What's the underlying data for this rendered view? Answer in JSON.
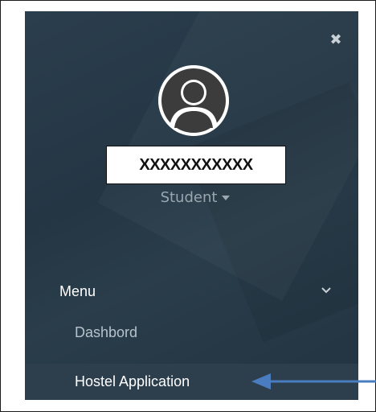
{
  "sidebar": {
    "close_icon": "close-icon",
    "user": {
      "name": "XXXXXXXXXXX",
      "role": "Student"
    },
    "menu": {
      "title": "Menu",
      "items": [
        {
          "label": "Dashbord"
        },
        {
          "label": "Hostel Application"
        }
      ]
    }
  },
  "colors": {
    "sidebar_bg": "#243644",
    "active_item_bg": "#2d3e4d",
    "arrow": "#4a7dbf"
  }
}
